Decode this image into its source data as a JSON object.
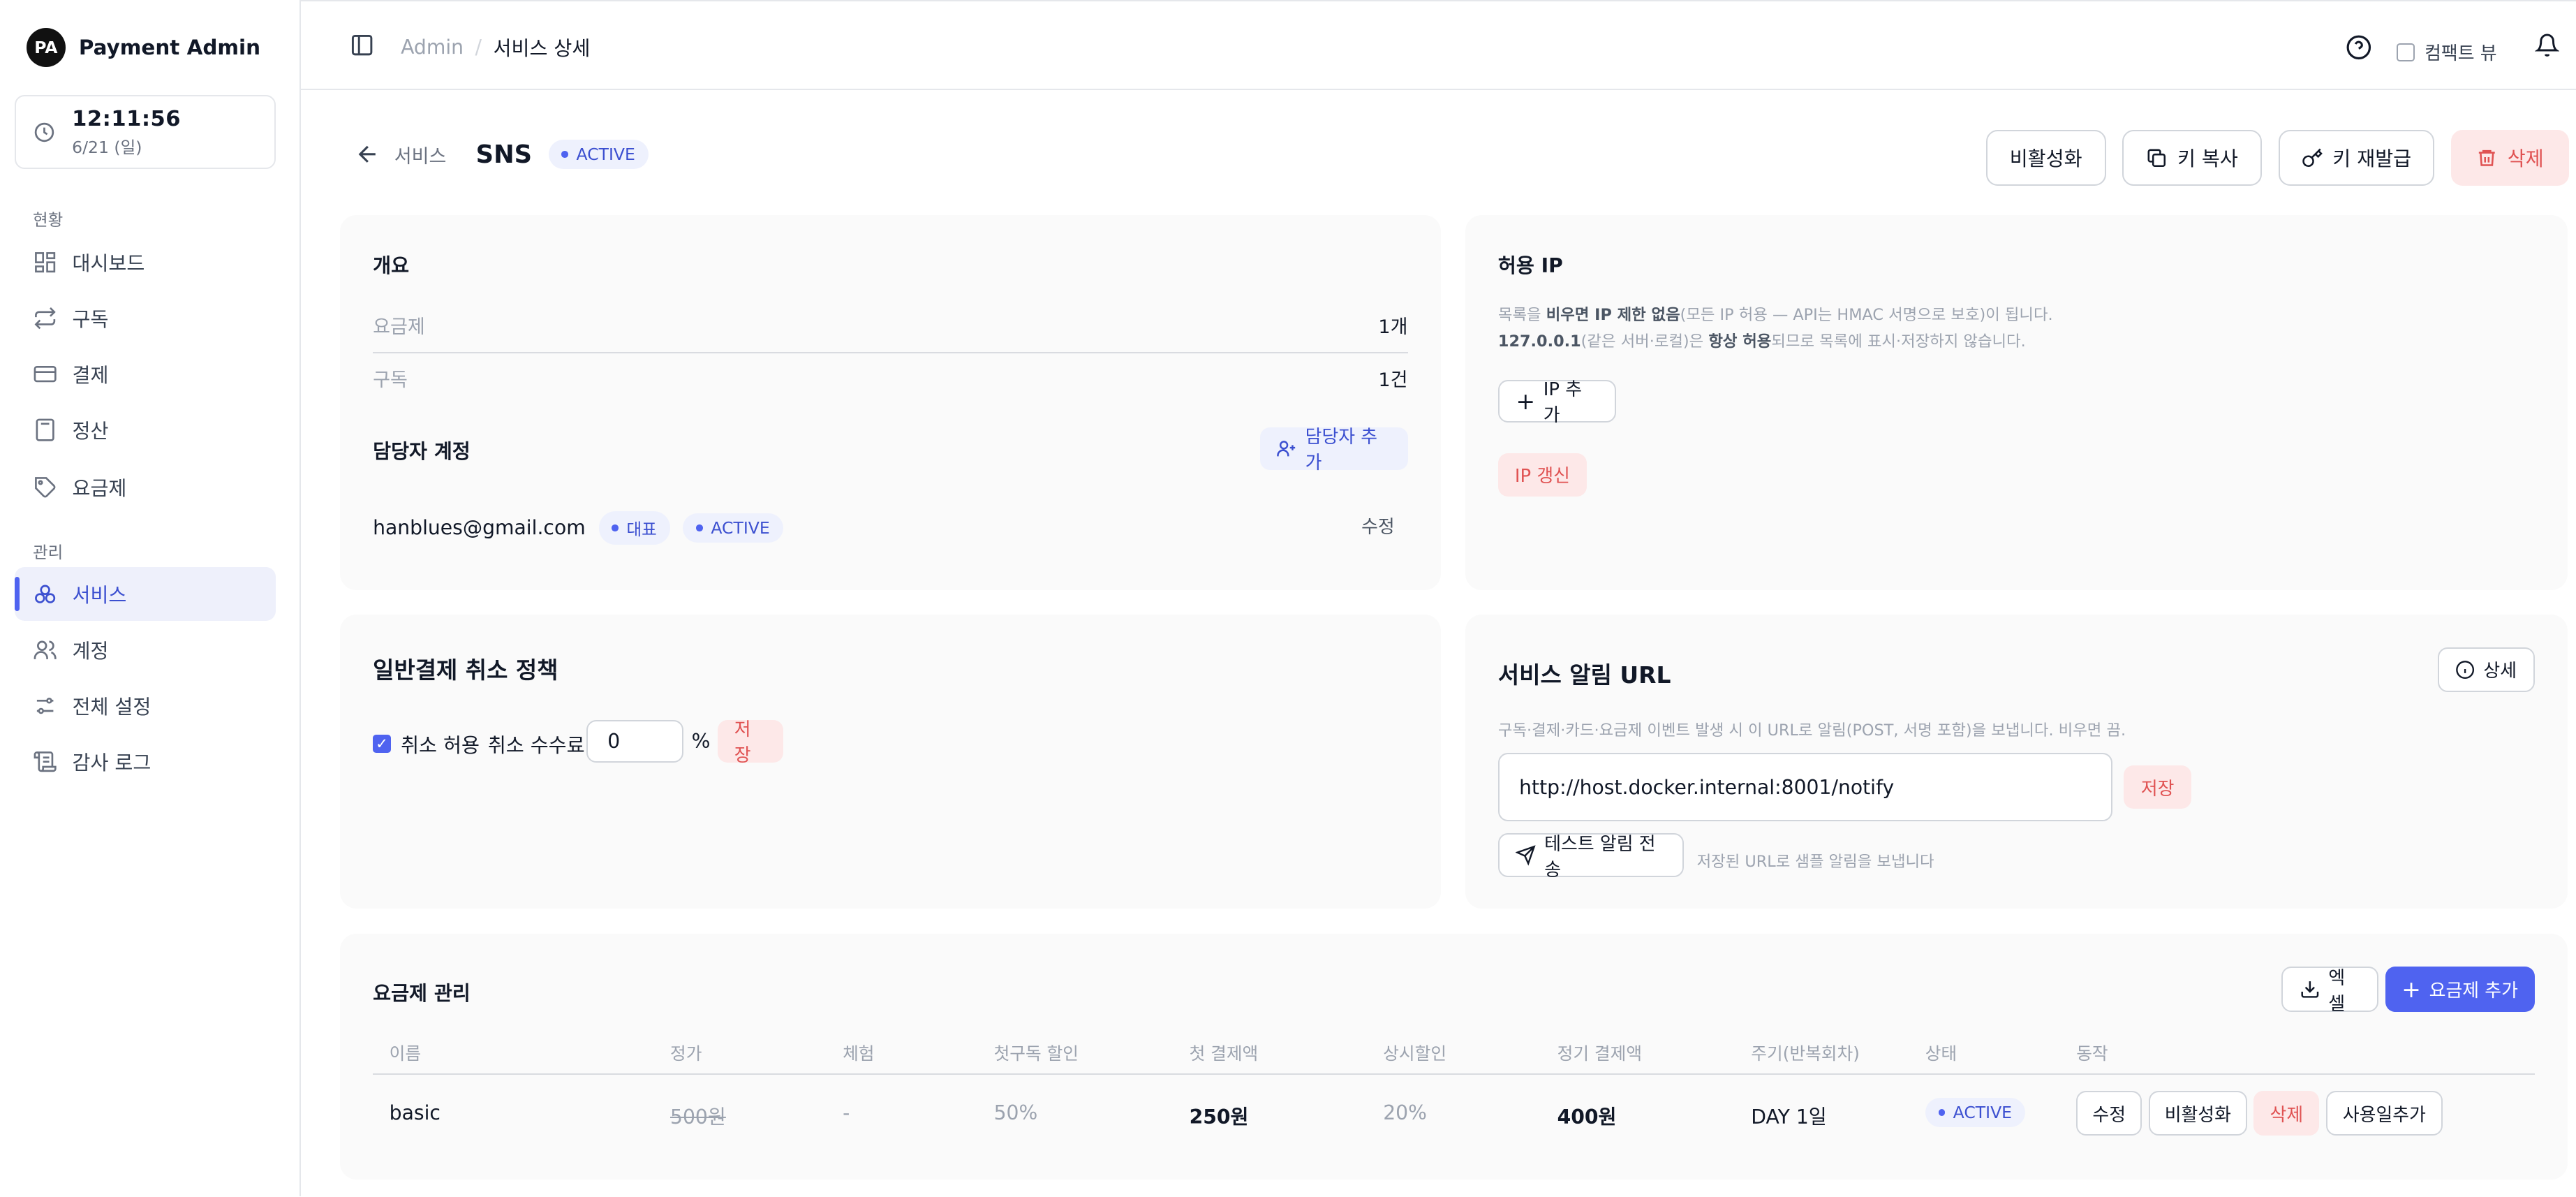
{
  "brand": {
    "logo": "PA",
    "name": "Payment Admin"
  },
  "clock": {
    "time": "12:11:56",
    "date": "6/21 (일)"
  },
  "sidebar": {
    "section_status": "현황",
    "section_manage": "관리",
    "items": [
      {
        "label": "대시보드",
        "icon": "dashboard-icon"
      },
      {
        "label": "구독",
        "icon": "repeat-icon"
      },
      {
        "label": "결제",
        "icon": "card-icon"
      },
      {
        "label": "정산",
        "icon": "calculator-icon"
      },
      {
        "label": "요금제",
        "icon": "tag-icon"
      },
      {
        "label": "서비스",
        "icon": "services-icon",
        "active": true
      },
      {
        "label": "계정",
        "icon": "users-icon"
      },
      {
        "label": "전체 설정",
        "icon": "settings-icon"
      },
      {
        "label": "감사 로그",
        "icon": "scroll-icon"
      }
    ]
  },
  "topbar": {
    "breadcrumb_root": "Admin",
    "breadcrumb_sep": "/",
    "breadcrumb_current": "서비스 상세",
    "compact_label": "컴팩트 뷰"
  },
  "page": {
    "back_label": "서비스",
    "service_name": "SNS",
    "status": "ACTIVE",
    "actions": {
      "deactivate": "비활성화",
      "copy_key": "키 복사",
      "reissue_key": "키 재발급",
      "delete": "삭제"
    }
  },
  "overview": {
    "title": "개요",
    "plans_label": "요금제",
    "plans_value": "1개",
    "subs_label": "구독",
    "subs_value": "1건",
    "managers_title": "담당자 계정",
    "add_manager": "담당자 추가",
    "manager_email": "hanblues@gmail.com",
    "manager_badge_role": "대표",
    "manager_badge_status": "ACTIVE",
    "manager_edit": "수정"
  },
  "allowed_ip": {
    "title": "허용 IP",
    "desc1_a": "목록을 ",
    "desc1_b": "비우면 IP 제한 없음",
    "desc1_c": "(모든 IP 허용 — API는 HMAC 서명으로 보호)이 됩니다.",
    "desc2_a": "127.0.0.1",
    "desc2_b": "(같은 서버·로컬)은 ",
    "desc2_c": "항상 허용",
    "desc2_d": "되므로 목록에 표시·저장하지 않습니다.",
    "add_ip": "IP 추가",
    "refresh_ip": "IP 갱신"
  },
  "cancel_policy": {
    "title": "일반결제 취소 정책",
    "allow_label": "취소 허용",
    "allow_checked": true,
    "fee_label": "취소 수수료",
    "fee_value": "0",
    "fee_unit": "%",
    "save": "저장"
  },
  "notify": {
    "title": "서비스 알림 URL",
    "detail": "상세",
    "desc": "구독·결제·카드·요금제 이벤트 발생 시 이 URL로 알림(POST, 서명 포함)을 보냅니다. 비우면 끔.",
    "url": "http://host.docker.internal:8001/notify",
    "save": "저장",
    "test": "테스트 알림 전송",
    "test_hint": "저장된 URL로 샘플 알림을 보냅니다"
  },
  "plans": {
    "title": "요금제 관리",
    "excel": "엑셀",
    "add": "요금제 추가",
    "columns": [
      "이름",
      "정가",
      "체험",
      "첫구독 할인",
      "첫 결제액",
      "상시할인",
      "정기 결제액",
      "주기(반복회차)",
      "상태",
      "동작"
    ],
    "rows": [
      {
        "name": "basic",
        "list_price": "500원",
        "trial": "-",
        "first_discount": "50%",
        "first_amount": "250원",
        "always_discount": "20%",
        "recurring_amount": "400원",
        "cycle": "DAY 1일",
        "status": "ACTIVE",
        "actions": {
          "edit": "수정",
          "deactivate": "비활성화",
          "delete": "삭제",
          "add_days": "사용일추가"
        }
      }
    ]
  }
}
